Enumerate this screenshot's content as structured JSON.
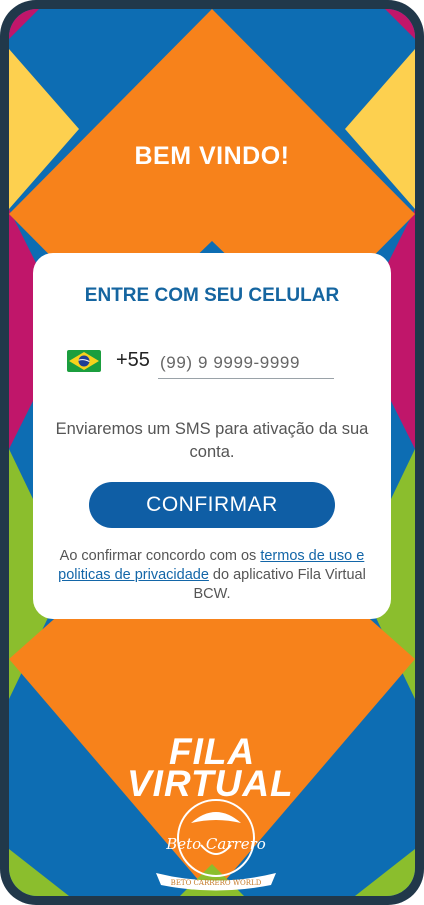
{
  "header": {
    "title": "BEM VINDO!"
  },
  "login": {
    "title": "ENTRE COM SEU CELULAR",
    "country_code": "+55",
    "phone_placeholder": "(99) 9 9999-9999",
    "sms_text": "Enviaremos um SMS para ativação da sua conta.",
    "confirm_label": "CONFIRMAR",
    "terms_prefix": "Ao confirmar concordo com os ",
    "terms_link": "termos de uso e politicas de privacidade",
    "terms_suffix": " do aplicativo Fila Virtual BCW."
  },
  "brand": {
    "line1": "FILA",
    "line2": "VIRTUAL",
    "emblem_signature": "Beto Carrero",
    "emblem_ribbon": "BETO CARRERO WORLD"
  },
  "colors": {
    "blue": "#0d6db3",
    "orange": "#f7821b",
    "yellow": "#fdd04f",
    "magenta": "#c0166a",
    "green": "#8bbe2d",
    "primary_button": "#0f5ea5",
    "title_blue": "#1565a0"
  },
  "icons": {
    "flag": "brazil-flag-icon"
  }
}
